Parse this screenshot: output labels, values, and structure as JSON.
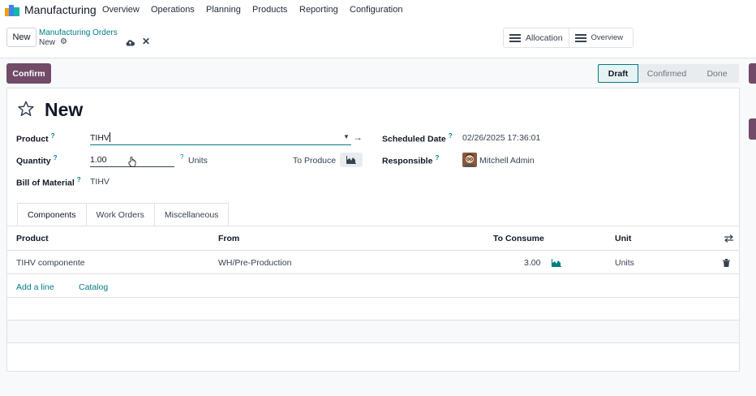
{
  "nav": {
    "app_name": "Manufacturing",
    "menu": [
      "Overview",
      "Operations",
      "Planning",
      "Products",
      "Reporting",
      "Configuration"
    ]
  },
  "control": {
    "new_label": "New",
    "breadcrumb_parent": "Manufacturing Orders",
    "breadcrumb_current": "New",
    "switch": [
      "Allocation",
      "Overview"
    ]
  },
  "actions": {
    "confirm": "Confirm"
  },
  "status": [
    "Draft",
    "Confirmed",
    "Done"
  ],
  "form": {
    "title": "New",
    "product_label": "Product",
    "product_value": "TIHV",
    "quantity_label": "Quantity",
    "quantity_value": "1.00",
    "quantity_unit": "Units",
    "to_produce_label": "To Produce",
    "bom_label": "Bill of Material",
    "bom_value": "TIHV",
    "scheduled_label": "Scheduled Date",
    "scheduled_value": "02/26/2025 17:36:01",
    "responsible_label": "Responsible",
    "responsible_value": "Mitchell Admin",
    "help_mark": "?"
  },
  "tabs": [
    "Components",
    "Work Orders",
    "Miscellaneous"
  ],
  "table": {
    "headers": [
      "Product",
      "From",
      "To Consume",
      "Unit"
    ],
    "rows": [
      {
        "product": "TIHV componente",
        "from": "WH/Pre-Production",
        "to_consume": "3.00",
        "unit": "Units"
      }
    ],
    "add_line": "Add a line",
    "catalog": "Catalog"
  },
  "colors": {
    "primary": "#714b67",
    "accent": "#017e84"
  }
}
